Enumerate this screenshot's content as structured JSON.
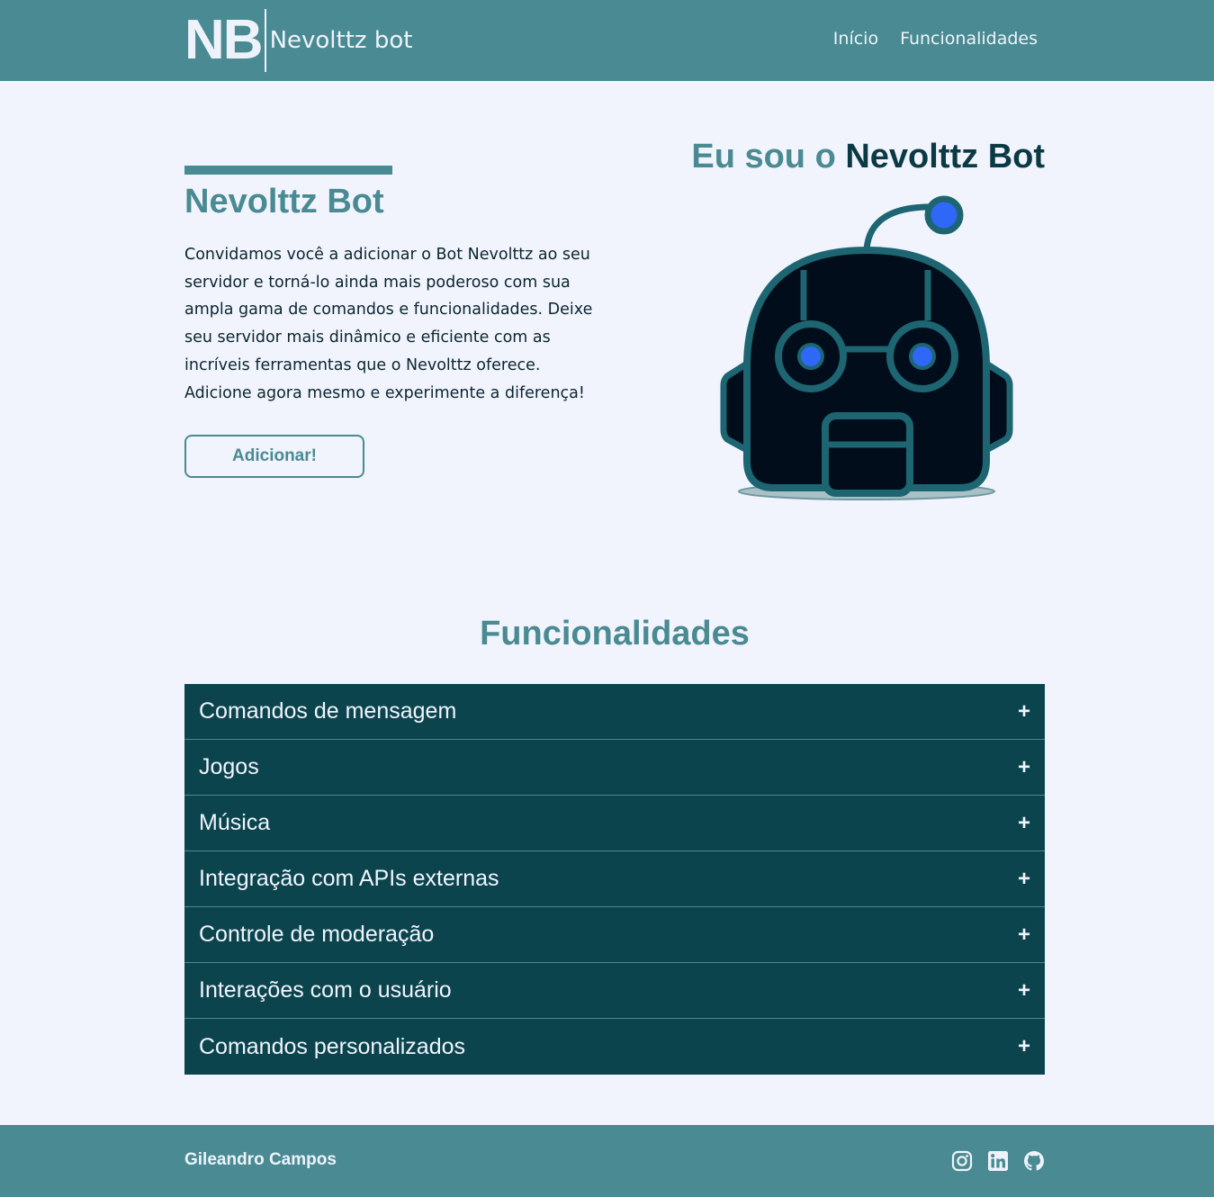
{
  "header": {
    "logo_mark": "NB",
    "logo_name": "Nevolttz bot",
    "nav": [
      "Início",
      "Funcionalidades"
    ]
  },
  "hero": {
    "title": "Nevolttz Bot",
    "description": "Convidamos você a adicionar o Bot Nevolttz ao seu servidor e torná-lo ainda mais poderoso com sua ampla gama de comandos e funcionalidades. Deixe seu servidor mais dinâmico e eficiente com as incríveis ferramentas que o Nevolttz oferece. Adicione agora mesmo e experimente a diferença!",
    "button_label": "Adicionar!",
    "heading_light": "Eu sou o ",
    "heading_strong": "Nevolttz Bot"
  },
  "features": {
    "title": "Funcionalidades",
    "plus_symbol": "+",
    "items": [
      "Comandos de mensagem",
      "Jogos",
      "Música",
      "Integração com APIs externas",
      "Controle de moderação",
      "Interações com o usuário",
      "Comandos personalizados"
    ]
  },
  "footer": {
    "name": "Gileandro Campos",
    "social_icons": [
      "instagram-icon",
      "linkedin-icon",
      "github-icon"
    ]
  },
  "colors": {
    "primary": "#4a8a92",
    "dark": "#0b444d",
    "background": "#f1f4fd",
    "robot_body": "#020d1c",
    "robot_eye": "#2f67f6"
  }
}
